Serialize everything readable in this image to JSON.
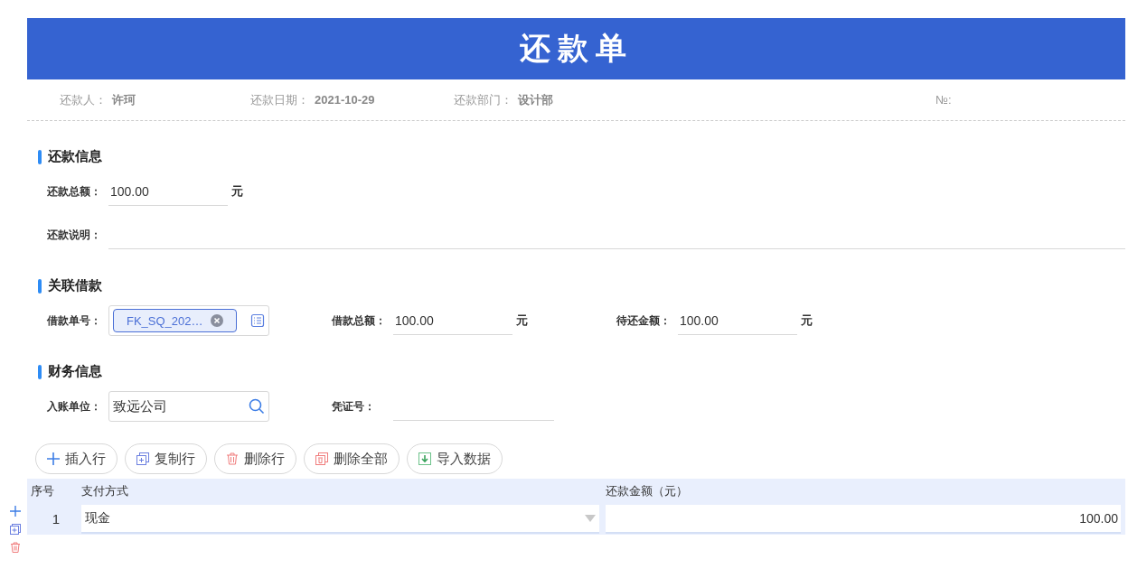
{
  "title": "还款单",
  "meta": [
    {
      "label": "还款人：",
      "value": "许珂"
    },
    {
      "label": "还款日期：",
      "value": "2021-10-29"
    },
    {
      "label": "还款部门：",
      "value": "设计部"
    },
    {
      "label": "№:"
    }
  ],
  "sections": [
    {
      "title": "还款信息",
      "rows": [
        [
          {
            "kind": "amount",
            "label": "还款总额：",
            "value": "100.00",
            "unit": "元"
          }
        ],
        [
          {
            "kind": "wide",
            "label": "还款说明："
          }
        ]
      ]
    },
    {
      "title": "关联借款",
      "rows": [
        [
          {
            "kind": "tag-picker",
            "label": "借款单号：",
            "tag": "FK_SQ_202…"
          },
          {
            "kind": "amount",
            "label": "借款总额：",
            "value": "100.00",
            "unit": "元"
          },
          {
            "kind": "amount",
            "label": "待还金额：",
            "value": "100.00",
            "unit": "元"
          }
        ]
      ]
    },
    {
      "title": "财务信息",
      "rows": [
        [
          {
            "kind": "search",
            "label": "入账单位：",
            "value": "致远公司"
          },
          {
            "kind": "line",
            "label": "凭证号："
          }
        ]
      ]
    }
  ],
  "toolbar": [
    {
      "kind": "insert",
      "label": "插入行"
    },
    {
      "kind": "copy",
      "label": "复制行"
    },
    {
      "kind": "delete",
      "label": "删除行"
    },
    {
      "kind": "delete-all",
      "label": "删除全部"
    },
    {
      "kind": "import",
      "label": "导入数据"
    }
  ],
  "table": {
    "columns": [
      "序号",
      "支付方式",
      "还款金额（元）"
    ],
    "rows": [
      {
        "index": "1",
        "payment": "现金",
        "amount": "100.00"
      }
    ]
  }
}
